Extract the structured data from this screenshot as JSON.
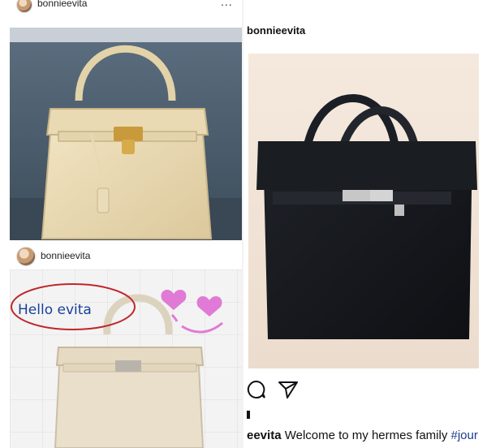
{
  "left_top_post": {
    "username": "bonnieevita",
    "more": "..."
  },
  "left_bottom_post": {
    "username": "bonnieevita",
    "handwritten": "Hello evita"
  },
  "right_post": {
    "username": "bonnieevita",
    "caption_user": "eevita",
    "caption_text": "Welcome to my hermes family",
    "caption_hashtag": "#jour"
  },
  "colors": {
    "accent_pink": "#e07ad6",
    "hashtag_blue": "#1c3b8c",
    "handwriting_blue": "#1a3f9a",
    "circle_red": "#c0262a"
  },
  "icons": [
    "comment-icon",
    "share-icon",
    "more-options-icon"
  ]
}
